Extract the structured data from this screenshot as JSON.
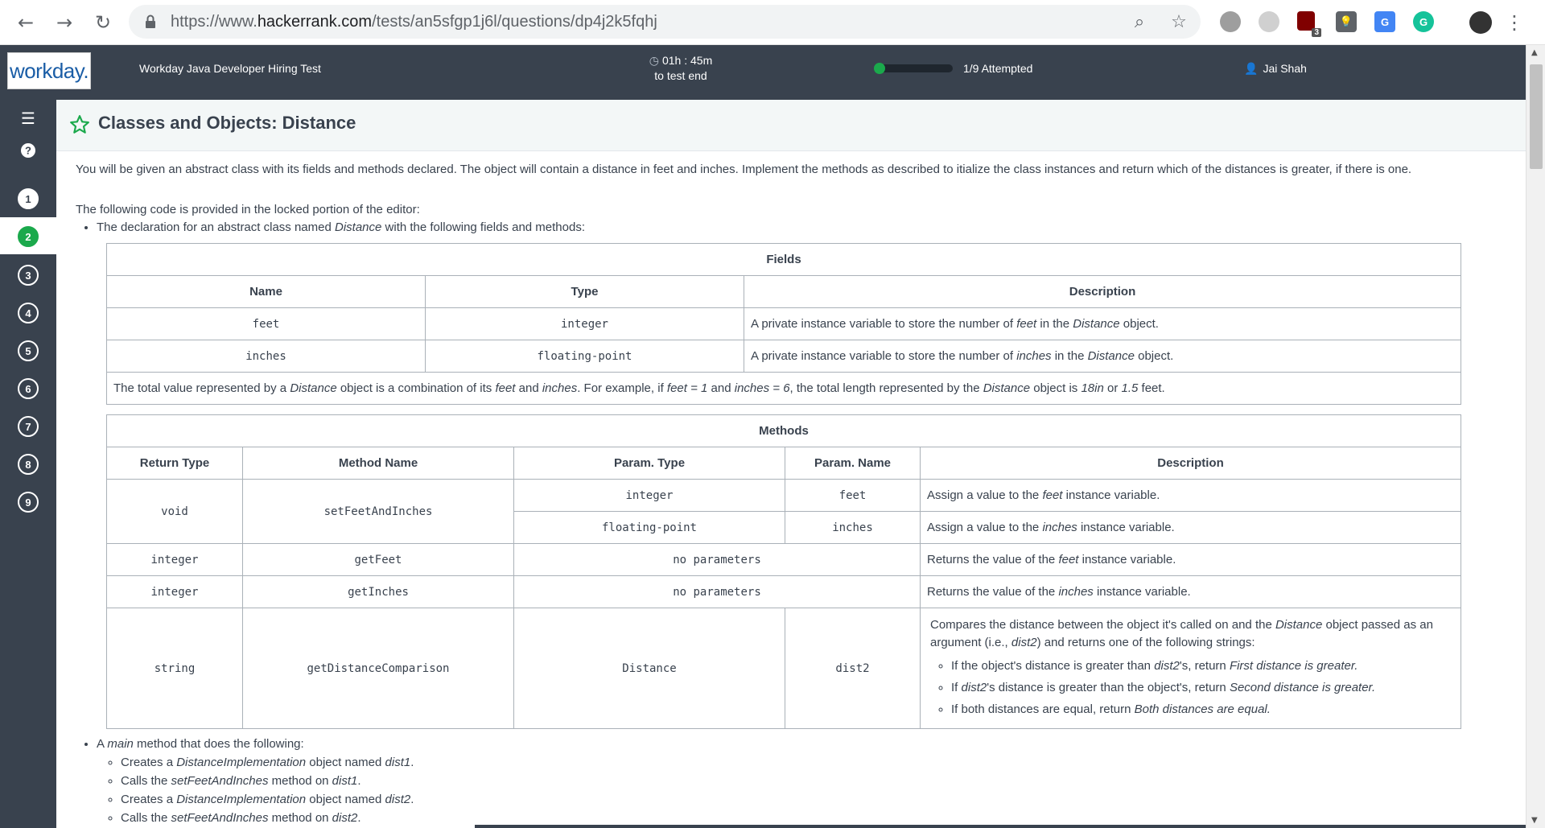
{
  "browser": {
    "url_prefix": "https://www.",
    "url_host": "hackerrank.com",
    "url_path": "/tests/an5sfgp1j6l/questions/dp4j2k5fqhj",
    "ext_badge": "3"
  },
  "header": {
    "logo_text": "workday.",
    "test_name": "Workday Java Developer Hiring Test",
    "time_left": "01h : 45m",
    "time_caption": "to test end",
    "progress_fraction": 0.11,
    "attempted": "1/9 Attempted",
    "user_name": "Jai Shah"
  },
  "sidebar": {
    "questions": [
      "1",
      "2",
      "3",
      "4",
      "5",
      "6",
      "7",
      "8",
      "9"
    ],
    "current": "2"
  },
  "question": {
    "title": "Classes and Objects: Distance",
    "intro": "You will be given an abstract class with its fields and methods declared. The object will contain a distance in feet and inches. Implement the methods as described to itialize the class instances and return which of the distances is greater, if there is one.",
    "locked_intro": "The following code is provided in the locked portion of the editor:",
    "bullet1_a": "The declaration for an abstract class named ",
    "bullet1_em": "Distance",
    "bullet1_b": " with the following fields and methods:",
    "fields": {
      "caption": "Fields",
      "headers": [
        "Name",
        "Type",
        "Description"
      ],
      "rows": [
        {
          "name": "feet",
          "type": "integer",
          "d1": "A private instance variable to store the number of ",
          "d2": "feet",
          "d3": " in the ",
          "d4": "Distance",
          "d5": " object."
        },
        {
          "name": "inches",
          "type": "floating-point",
          "d1": "A private instance variable to store the number of ",
          "d2": "inches",
          "d3": " in the ",
          "d4": "Distance",
          "d5": " object."
        }
      ],
      "note": {
        "a": "The total value represented by a ",
        "b": "Distance",
        "c": " object is a combination of its ",
        "d": "feet",
        "e": " and ",
        "f": "inches",
        "g": ". For example, if ",
        "h": "feet = 1",
        "i": " and ",
        "j": "inches = 6",
        "k": ", the total length represented by the ",
        "l": "Distance",
        "m": " object is ",
        "n": "18in",
        "o": " or ",
        "p": "1.5",
        "q": " feet."
      }
    },
    "methods": {
      "caption": "Methods",
      "headers": [
        "Return Type",
        "Method Name",
        "Param. Type",
        "Param. Name",
        "Description"
      ],
      "r1": {
        "ret": "void",
        "name": "setFeetAndInches",
        "pt1": "integer",
        "pn1": "feet",
        "d1a": "Assign a value to the ",
        "d1b": "feet",
        "d1c": " instance variable.",
        "pt2": "floating-point",
        "pn2": "inches",
        "d2a": "Assign a value to the ",
        "d2b": "inches",
        "d2c": " instance variable."
      },
      "r2": {
        "ret": "integer",
        "name": "getFeet",
        "params": "no parameters",
        "da": "Returns the value of the ",
        "db": "feet",
        "dc": " instance variable."
      },
      "r3": {
        "ret": "integer",
        "name": "getInches",
        "params": "no parameters",
        "da": "Returns the value of the ",
        "db": "inches",
        "dc": " instance variable."
      },
      "r4": {
        "ret": "string",
        "name": "getDistanceComparison",
        "pt": "Distance",
        "pn": "dist2",
        "da": "Compares the distance between the object it's called on and the ",
        "db": "Distance",
        "dc": " object passed as an argument (i.e., ",
        "dd": "dist2",
        "de": ") and returns one of the following strings:",
        "opt1a": "If the object's distance is greater than ",
        "opt1b": "dist2",
        "opt1c": "'s, return ",
        "opt1d": "First distance is greater.",
        "opt2a": "If ",
        "opt2b": "dist2",
        "opt2c": "'s distance is greater than the object's, return ",
        "opt2d": "Second distance is greater.",
        "opt3a": "If both distances are equal, return ",
        "opt3b": "Both distances are equal."
      }
    },
    "main": {
      "a": "A ",
      "b": "main",
      "c": " method that does the following:",
      "s1a": "Creates a ",
      "s1b": "DistanceImplementation",
      "s1c": " object named ",
      "s1d": "dist1",
      "s1e": ".",
      "s2a": "Calls the ",
      "s2b": "setFeetAndInches",
      "s2c": " method on ",
      "s2d": "dist1",
      "s2e": ".",
      "s3a": "Creates a ",
      "s3b": "DistanceImplementation",
      "s3c": " object named ",
      "s3d": "dist2",
      "s3e": ".",
      "s4a": "Calls the ",
      "s4b": "setFeetAndInches",
      "s4c": " method on ",
      "s4d": "dist2",
      "s4e": "."
    }
  },
  "colors": {
    "header_bg": "#39424e",
    "accent_green": "#1ba94c"
  }
}
